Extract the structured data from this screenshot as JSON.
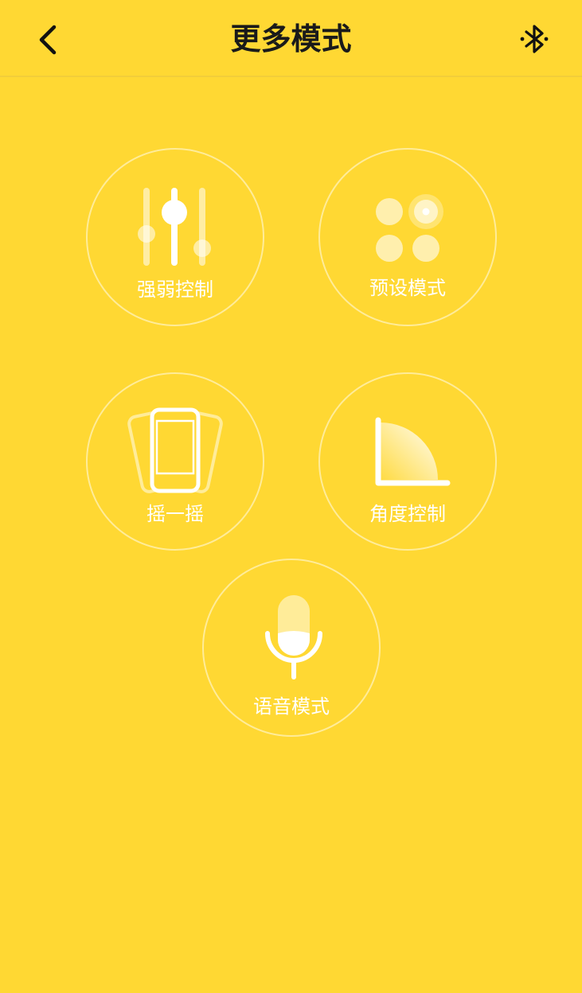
{
  "header": {
    "title": "更多模式",
    "back_icon": "chevron-left-icon",
    "bluetooth_icon": "bluetooth-icon"
  },
  "modes": [
    {
      "label": "强弱控制",
      "icon": "sliders-icon"
    },
    {
      "label": "预设模式",
      "icon": "preset-dots-icon"
    },
    {
      "label": "摇一摇",
      "icon": "shake-phone-icon"
    },
    {
      "label": "角度控制",
      "icon": "angle-icon"
    },
    {
      "label": "语音模式",
      "icon": "microphone-icon"
    }
  ],
  "colors": {
    "background": "#FFD833",
    "title": "#1a1a1a",
    "icon": "#ffffff"
  }
}
